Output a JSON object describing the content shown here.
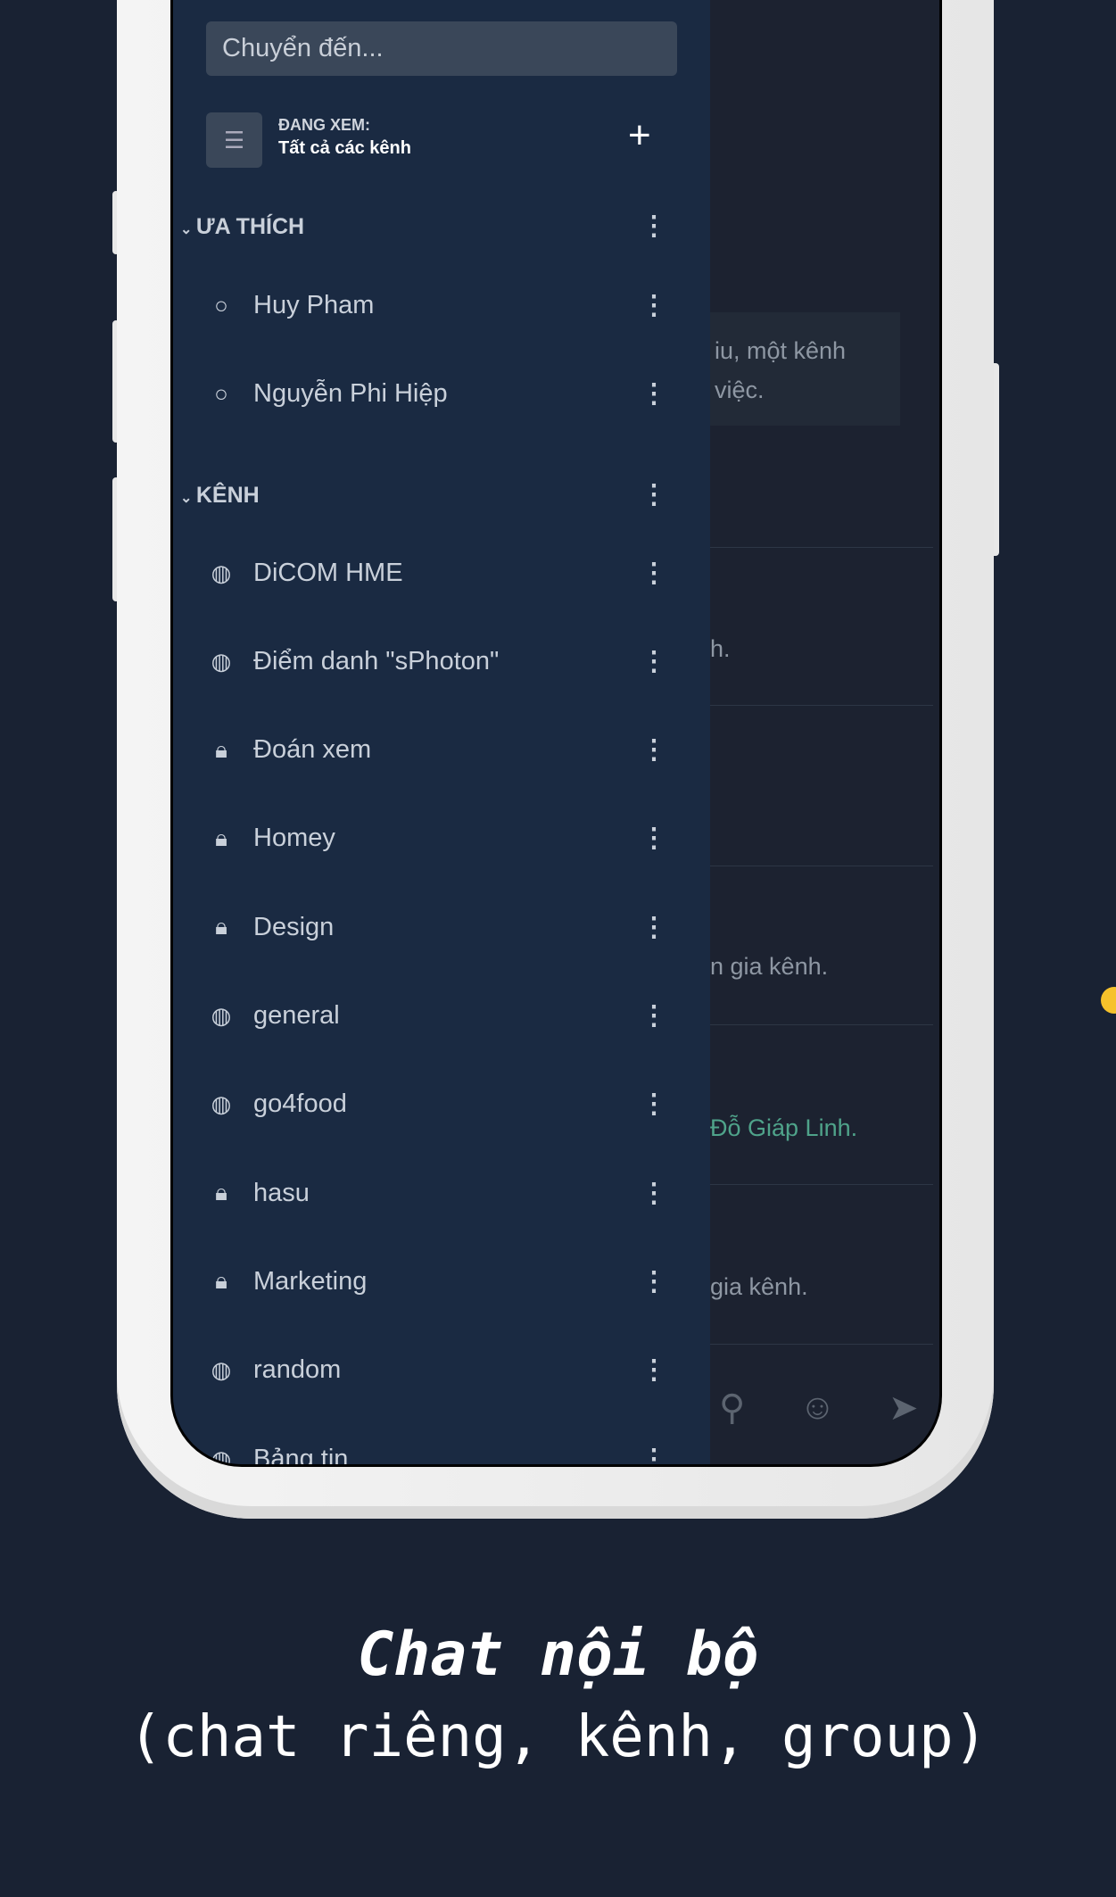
{
  "search": {
    "placeholder": "Chuyển đến..."
  },
  "filter": {
    "label": "ĐANG XEM:",
    "value": "Tất cả các kênh"
  },
  "favorites": {
    "title": "ƯA THÍCH",
    "items": [
      {
        "label": "Huy Pham",
        "icon": "circle-icon"
      },
      {
        "label": "Nguyễn Phi Hiệp",
        "icon": "circle-icon"
      }
    ]
  },
  "channels": {
    "title": "KÊNH",
    "items": [
      {
        "label": "DiCOM HME",
        "icon": "globe-icon"
      },
      {
        "label": "Điểm danh \"sPhoton\"",
        "icon": "globe-icon"
      },
      {
        "label": "Đoán xem",
        "icon": "lock-icon"
      },
      {
        "label": "Homey",
        "icon": "lock-icon"
      },
      {
        "label": "Design",
        "icon": "lock-icon"
      },
      {
        "label": "general",
        "icon": "globe-icon"
      },
      {
        "label": "go4food",
        "icon": "globe-icon"
      },
      {
        "label": "hasu",
        "icon": "lock-icon"
      },
      {
        "label": "Marketing",
        "icon": "lock-icon"
      },
      {
        "label": "random",
        "icon": "globe-icon"
      },
      {
        "label": "Bảng tin",
        "icon": "globe-icon"
      }
    ]
  },
  "chat": {
    "messages": [
      "iu, một kênh",
      "việc.",
      "h.",
      "n gia kênh.",
      "Đỗ Giáp Linh.",
      "gia kênh."
    ]
  },
  "caption": {
    "title": "Chat nội bộ",
    "subtitle": "(chat riêng, kênh, group)"
  },
  "colors": {
    "background": "#192233",
    "sidebar": "#1a2a42",
    "accent_dot": "#f6c22b",
    "mention": "#4fa38a"
  }
}
